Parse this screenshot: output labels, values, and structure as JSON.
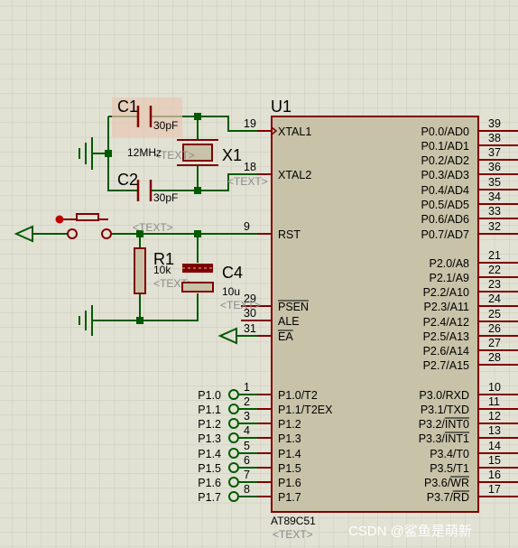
{
  "component": {
    "ref": "U1",
    "part": "AT89C51",
    "text_placeholder": "<TEXT>"
  },
  "left_pins": [
    {
      "num": "19",
      "label": "XTAL1"
    },
    {
      "num": "18",
      "label": "XTAL2"
    },
    {
      "num": "9",
      "label": "RST"
    },
    {
      "num": "29",
      "label": "PSEN",
      "overbar": true
    },
    {
      "num": "30",
      "label": "ALE"
    },
    {
      "num": "31",
      "label": "EA",
      "overbar": true
    },
    {
      "num": "1",
      "label": "P1.0/T2"
    },
    {
      "num": "2",
      "label": "P1.1/T2EX"
    },
    {
      "num": "3",
      "label": "P1.2"
    },
    {
      "num": "4",
      "label": "P1.3"
    },
    {
      "num": "5",
      "label": "P1.4"
    },
    {
      "num": "6",
      "label": "P1.5"
    },
    {
      "num": "7",
      "label": "P1.6"
    },
    {
      "num": "8",
      "label": "P1.7"
    }
  ],
  "right_pins": [
    {
      "num": "39",
      "label": "P0.0/AD0"
    },
    {
      "num": "38",
      "label": "P0.1/AD1"
    },
    {
      "num": "37",
      "label": "P0.2/AD2"
    },
    {
      "num": "36",
      "label": "P0.3/AD3"
    },
    {
      "num": "35",
      "label": "P0.4/AD4"
    },
    {
      "num": "34",
      "label": "P0.5/AD5"
    },
    {
      "num": "33",
      "label": "P0.6/AD6"
    },
    {
      "num": "32",
      "label": "P0.7/AD7"
    },
    {
      "num": "21",
      "label": "P2.0/A8"
    },
    {
      "num": "22",
      "label": "P2.1/A9"
    },
    {
      "num": "23",
      "label": "P2.2/A10"
    },
    {
      "num": "24",
      "label": "P2.3/A11"
    },
    {
      "num": "25",
      "label": "P2.4/A12"
    },
    {
      "num": "26",
      "label": "P2.5/A13"
    },
    {
      "num": "27",
      "label": "P2.6/A14"
    },
    {
      "num": "28",
      "label": "P2.7/A15"
    },
    {
      "num": "10",
      "label": "P3.0/RXD"
    },
    {
      "num": "11",
      "label": "P3.1/TXD"
    },
    {
      "num": "12",
      "label": "P3.2/INT0",
      "overbar_part": "INT0"
    },
    {
      "num": "13",
      "label": "P3.3/INT1",
      "overbar_part": "INT1"
    },
    {
      "num": "14",
      "label": "P3.4/T0"
    },
    {
      "num": "15",
      "label": "P3.5/T1"
    },
    {
      "num": "16",
      "label": "P3.6/WR",
      "overbar_part": "WR"
    },
    {
      "num": "17",
      "label": "P3.7/RD",
      "overbar_part": "RD"
    }
  ],
  "terminals": [
    "P1.0",
    "P1.1",
    "P1.2",
    "P1.3",
    "P1.4",
    "P1.5",
    "P1.6",
    "P1.7"
  ],
  "parts": {
    "c1": {
      "ref": "C1",
      "value": "30pF"
    },
    "c2": {
      "ref": "C2",
      "value": "30pF"
    },
    "x1": {
      "ref": "X1",
      "value": "12MHz",
      "text": "<TEXT>"
    },
    "r1": {
      "ref": "R1",
      "value": "10k",
      "text": "<TEXT>"
    },
    "c4": {
      "ref": "C4",
      "value": "10u",
      "text": "<TEXT>"
    },
    "button": {
      "text": "<TEXT>"
    }
  },
  "watermark": "CSDN @鲨鱼是萌新",
  "colors": {
    "background": "#e1e1d4",
    "grid": "#cacabc",
    "wire": "#005a00",
    "part": "#800000",
    "chip_fill": "#c8c2a8",
    "text": "#000000",
    "grey_text": "#8a8a8a"
  }
}
